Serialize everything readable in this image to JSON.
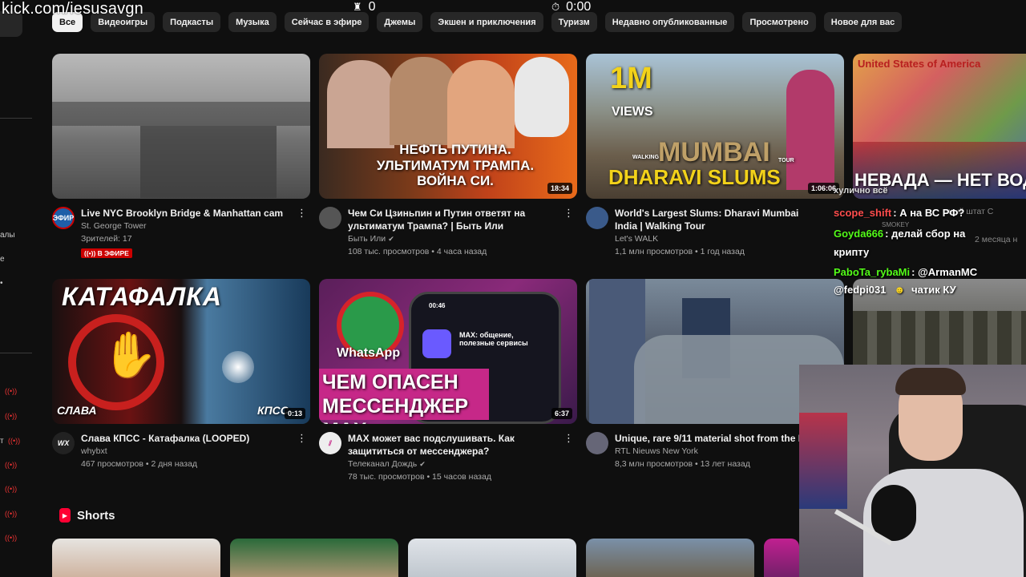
{
  "overlay": {
    "url": "kick.com/iesusavgn",
    "viewers": "0",
    "timer": "0:00"
  },
  "sidebar": {
    "frag_1": "алы",
    "frag_2": "е",
    "frag_3": "т"
  },
  "chips": [
    "Все",
    "Видеоигры",
    "Подкасты",
    "Музыка",
    "Сейчас в эфире",
    "Джемы",
    "Экшен и приключения",
    "Туризм",
    "Недавно опубликованные",
    "Просмотрено",
    "Новое для вас"
  ],
  "videos": [
    {
      "title": "Live NYC Brooklyn Bridge & Manhattan cam",
      "channel": "St. George Tower",
      "stats": "Зрителей: 17",
      "badge": "((•)) В ЭФИРЕ",
      "avatar_label": "ЭФИР",
      "duration": ""
    },
    {
      "title": "Чем Си Цзиньпин и Путин ответят на ультиматум Трампа? | Быть Или",
      "channel": "Быть Или",
      "verified": true,
      "stats": "108 тыс. просмотров • 4 часа назад",
      "duration": "18:34",
      "thumb_text": "НЕФТЬ ПУТИНА. УЛЬТИМАТУМ ТРАМПА. ВОЙНА СИ."
    },
    {
      "title": "World's Largest Slums: Dharavi Mumbai India | Walking Tour",
      "channel": "Let's WALK",
      "stats": "1,1 млн просмотров • 1 год назад",
      "duration": "1:06:06",
      "thumb_big": "1M",
      "thumb_views": "VIEWS",
      "thumb_walking": "WALKING",
      "thumb_city": "MUMBAI",
      "thumb_tour": "TOUR",
      "thumb_slums": "DHARAVI SLUMS"
    },
    {
      "title": "Слава КПСС - Катафалка (LOOPED)",
      "channel": "whybxt",
      "stats": "467 просмотров • 2 дня назад",
      "duration": "0:13",
      "avatar_label": "WX",
      "thumb_top": "КАТАФАЛКА",
      "thumb_left": "СЛАВА",
      "thumb_right": "КПСС"
    },
    {
      "title": "MAX может вас подслушивать. Как защититься от мессенджера?",
      "channel": "Телеканал Дождь",
      "verified": true,
      "stats": "78 тыс. просмотров • 15 часов назад",
      "duration": "6:37",
      "thumb_text": "ЧЕМ ОПАСЕН МЕССЕНДЖЕР MAX",
      "thumb_app": "WhatsApp",
      "thumb_phone": "MAX: общение, полезные сервисы",
      "thumb_time": "00:46"
    },
    {
      "title": "Unique, rare 9/11 material shot from the H",
      "channel": "RTL Nieuws New York",
      "stats": "8,3 млн просмотров • 13 лет назад",
      "duration": ""
    }
  ],
  "partial_card": {
    "thumb_text": "НЕВАДА — НЕТ ВОДЫ",
    "map_title": "United States of America",
    "stats_fragment": "мный штат С",
    "time_fragment": "2 месяца н",
    "channel_fragment": "SMOKEY"
  },
  "shorts": {
    "label": "Shorts"
  },
  "chat": [
    {
      "user": "хулично всё",
      "text": "",
      "color": "#ffffff"
    },
    {
      "user": "scope_shift",
      "text": ": А на ВС РФ?",
      "color": "#ff4d4d"
    },
    {
      "user": "Goyda666",
      "text": ": делай сбор на",
      "color": "#53fc18"
    },
    {
      "user": "",
      "text": "крипту",
      "color": "#ffffff"
    },
    {
      "user": "PaboTa_rybaMi",
      "text": ": @ArmanMC",
      "color": "#53fc18"
    },
    {
      "user": "@fedpi031",
      "text": "чатик КУ",
      "color": "#ffffff"
    }
  ]
}
